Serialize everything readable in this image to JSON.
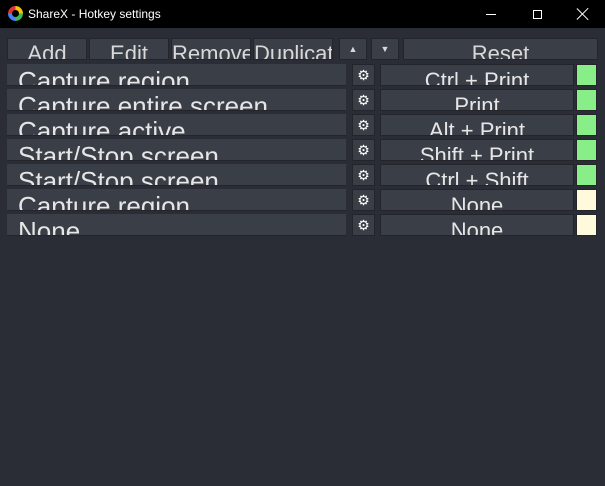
{
  "window": {
    "title": "ShareX - Hotkey settings"
  },
  "toolbar": {
    "buttons": [
      "Add",
      "Edit",
      "Remove",
      "Duplicate",
      "▲",
      "▼",
      "Reset"
    ]
  },
  "hotkeys": [
    {
      "description": "Capture region",
      "hotkey": "Ctrl + Print",
      "status": "registered"
    },
    {
      "description": "Capture entire screen",
      "hotkey": "Print",
      "status": "registered"
    },
    {
      "description": "Capture active",
      "hotkey": "Alt + Print",
      "status": "registered"
    },
    {
      "description": "Start/Stop screen",
      "hotkey": "Shift + Print",
      "status": "registered"
    },
    {
      "description": "Start/Stop screen",
      "hotkey": "Ctrl + Shift",
      "status": "registered"
    },
    {
      "description": "Capture region",
      "hotkey": "None",
      "status": "unset"
    },
    {
      "description": "None",
      "hotkey": "None",
      "status": "unset"
    }
  ],
  "colors": {
    "registered": "#88ee88",
    "unset": "#fffadb",
    "background": "#2a2d35",
    "control": "#3a3e47"
  },
  "icons": {
    "settings": "gear-icon"
  }
}
